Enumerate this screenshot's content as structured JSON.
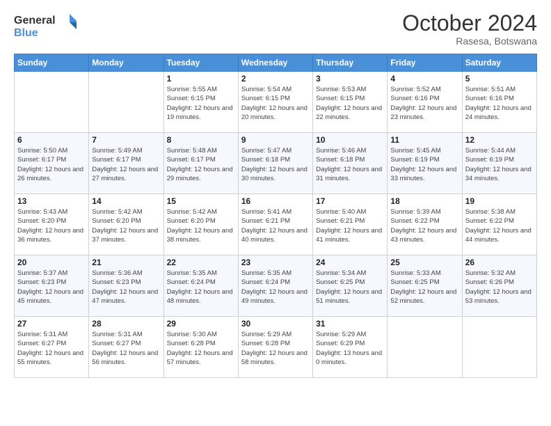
{
  "logo": {
    "line1": "General",
    "line2": "Blue"
  },
  "title": "October 2024",
  "subtitle": "Rasesa, Botswana",
  "days_of_week": [
    "Sunday",
    "Monday",
    "Tuesday",
    "Wednesday",
    "Thursday",
    "Friday",
    "Saturday"
  ],
  "weeks": [
    [
      {
        "day": "",
        "info": ""
      },
      {
        "day": "",
        "info": ""
      },
      {
        "day": "1",
        "info": "Sunrise: 5:55 AM\nSunset: 6:15 PM\nDaylight: 12 hours and 19 minutes."
      },
      {
        "day": "2",
        "info": "Sunrise: 5:54 AM\nSunset: 6:15 PM\nDaylight: 12 hours and 20 minutes."
      },
      {
        "day": "3",
        "info": "Sunrise: 5:53 AM\nSunset: 6:15 PM\nDaylight: 12 hours and 22 minutes."
      },
      {
        "day": "4",
        "info": "Sunrise: 5:52 AM\nSunset: 6:16 PM\nDaylight: 12 hours and 23 minutes."
      },
      {
        "day": "5",
        "info": "Sunrise: 5:51 AM\nSunset: 6:16 PM\nDaylight: 12 hours and 24 minutes."
      }
    ],
    [
      {
        "day": "6",
        "info": "Sunrise: 5:50 AM\nSunset: 6:17 PM\nDaylight: 12 hours and 26 minutes."
      },
      {
        "day": "7",
        "info": "Sunrise: 5:49 AM\nSunset: 6:17 PM\nDaylight: 12 hours and 27 minutes."
      },
      {
        "day": "8",
        "info": "Sunrise: 5:48 AM\nSunset: 6:17 PM\nDaylight: 12 hours and 29 minutes."
      },
      {
        "day": "9",
        "info": "Sunrise: 5:47 AM\nSunset: 6:18 PM\nDaylight: 12 hours and 30 minutes."
      },
      {
        "day": "10",
        "info": "Sunrise: 5:46 AM\nSunset: 6:18 PM\nDaylight: 12 hours and 31 minutes."
      },
      {
        "day": "11",
        "info": "Sunrise: 5:45 AM\nSunset: 6:19 PM\nDaylight: 12 hours and 33 minutes."
      },
      {
        "day": "12",
        "info": "Sunrise: 5:44 AM\nSunset: 6:19 PM\nDaylight: 12 hours and 34 minutes."
      }
    ],
    [
      {
        "day": "13",
        "info": "Sunrise: 5:43 AM\nSunset: 6:20 PM\nDaylight: 12 hours and 36 minutes."
      },
      {
        "day": "14",
        "info": "Sunrise: 5:42 AM\nSunset: 6:20 PM\nDaylight: 12 hours and 37 minutes."
      },
      {
        "day": "15",
        "info": "Sunrise: 5:42 AM\nSunset: 6:20 PM\nDaylight: 12 hours and 38 minutes."
      },
      {
        "day": "16",
        "info": "Sunrise: 5:41 AM\nSunset: 6:21 PM\nDaylight: 12 hours and 40 minutes."
      },
      {
        "day": "17",
        "info": "Sunrise: 5:40 AM\nSunset: 6:21 PM\nDaylight: 12 hours and 41 minutes."
      },
      {
        "day": "18",
        "info": "Sunrise: 5:39 AM\nSunset: 6:22 PM\nDaylight: 12 hours and 43 minutes."
      },
      {
        "day": "19",
        "info": "Sunrise: 5:38 AM\nSunset: 6:22 PM\nDaylight: 12 hours and 44 minutes."
      }
    ],
    [
      {
        "day": "20",
        "info": "Sunrise: 5:37 AM\nSunset: 6:23 PM\nDaylight: 12 hours and 45 minutes."
      },
      {
        "day": "21",
        "info": "Sunrise: 5:36 AM\nSunset: 6:23 PM\nDaylight: 12 hours and 47 minutes."
      },
      {
        "day": "22",
        "info": "Sunrise: 5:35 AM\nSunset: 6:24 PM\nDaylight: 12 hours and 48 minutes."
      },
      {
        "day": "23",
        "info": "Sunrise: 5:35 AM\nSunset: 6:24 PM\nDaylight: 12 hours and 49 minutes."
      },
      {
        "day": "24",
        "info": "Sunrise: 5:34 AM\nSunset: 6:25 PM\nDaylight: 12 hours and 51 minutes."
      },
      {
        "day": "25",
        "info": "Sunrise: 5:33 AM\nSunset: 6:25 PM\nDaylight: 12 hours and 52 minutes."
      },
      {
        "day": "26",
        "info": "Sunrise: 5:32 AM\nSunset: 6:26 PM\nDaylight: 12 hours and 53 minutes."
      }
    ],
    [
      {
        "day": "27",
        "info": "Sunrise: 5:31 AM\nSunset: 6:27 PM\nDaylight: 12 hours and 55 minutes."
      },
      {
        "day": "28",
        "info": "Sunrise: 5:31 AM\nSunset: 6:27 PM\nDaylight: 12 hours and 56 minutes."
      },
      {
        "day": "29",
        "info": "Sunrise: 5:30 AM\nSunset: 6:28 PM\nDaylight: 12 hours and 57 minutes."
      },
      {
        "day": "30",
        "info": "Sunrise: 5:29 AM\nSunset: 6:28 PM\nDaylight: 12 hours and 58 minutes."
      },
      {
        "day": "31",
        "info": "Sunrise: 5:29 AM\nSunset: 6:29 PM\nDaylight: 13 hours and 0 minutes."
      },
      {
        "day": "",
        "info": ""
      },
      {
        "day": "",
        "info": ""
      }
    ]
  ],
  "colors": {
    "header_bg": "#4a90d9",
    "accent": "#4a90d9"
  }
}
